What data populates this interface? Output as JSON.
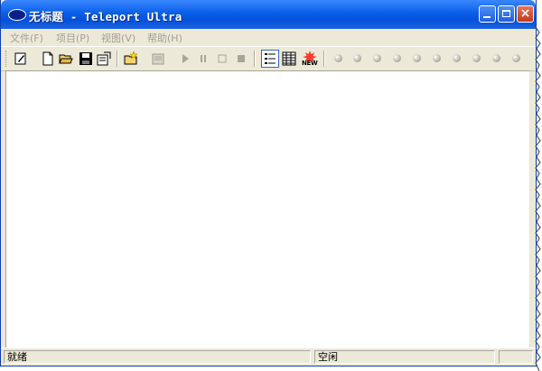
{
  "window": {
    "title": "无标题 - Teleport Ultra"
  },
  "menu": [
    {
      "label": "文件",
      "key": "(F)",
      "mnemonic": "F"
    },
    {
      "label": "项目",
      "key": "(P)",
      "mnemonic": "P"
    },
    {
      "label": "视图",
      "key": "(V)",
      "mnemonic": "V"
    },
    {
      "label": "帮助",
      "key": "(H)",
      "mnemonic": "H"
    }
  ],
  "toolbar": {
    "icons": [
      "wizard-icon",
      "new-file-icon",
      "open-folder-icon",
      "save-icon",
      "properties-icon",
      "new-project-icon",
      "scan-icon",
      "play-icon",
      "pause-icon",
      "stop-icon",
      "stop-all-icon",
      "details-view-icon",
      "grid-view-icon",
      "new-badge-icon"
    ],
    "new_badge": "NEW"
  },
  "statusbar": {
    "left": "就绪",
    "middle": "空闲",
    "right": ""
  },
  "colors": {
    "titlebar": "#0a5fe8",
    "chrome": "#ece9d8",
    "close_button": "#c23a1c"
  }
}
